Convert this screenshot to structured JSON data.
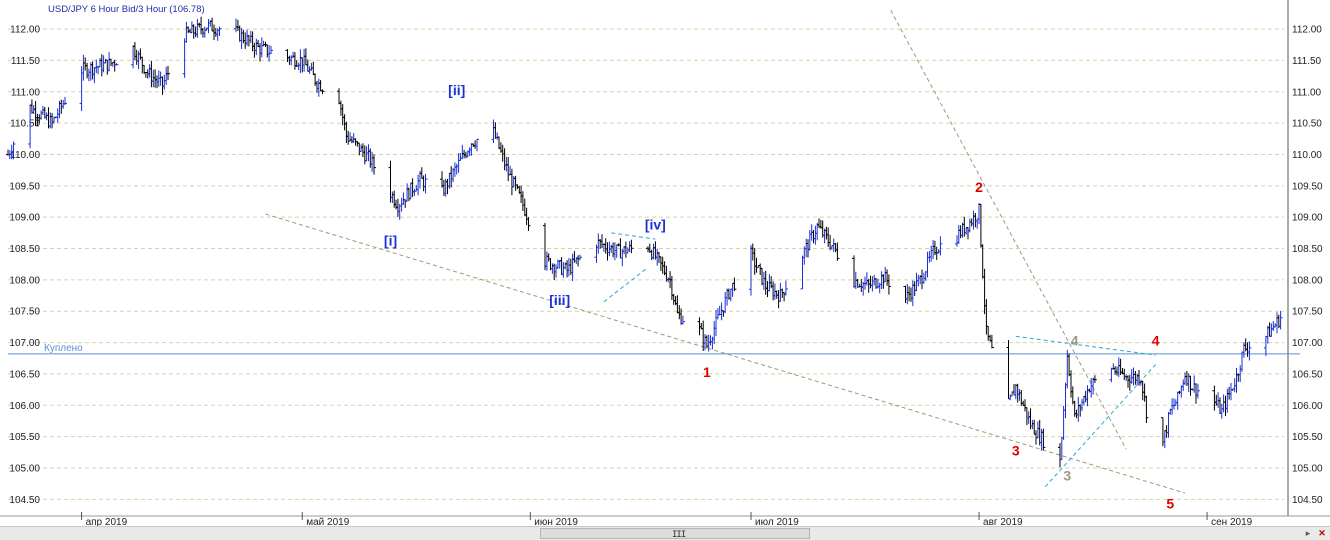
{
  "chart_data": {
    "type": "ohlc",
    "title": "USD/JPY 6 Hour Bid/3 Hour (106.78)",
    "instrument": "USD/JPY",
    "ylim": [
      104.25,
      112.4
    ],
    "y_ticks": [
      "112.00",
      "111.50",
      "111.00",
      "110.50",
      "110.00",
      "109.50",
      "109.00",
      "108.50",
      "108.00",
      "107.50",
      "107.00",
      "106.50",
      "106.00",
      "105.50",
      "105.00",
      "104.50"
    ],
    "x_ticks": [
      {
        "label": "апр 2019",
        "date": "2019-04-01"
      },
      {
        "label": "май 2019",
        "date": "2019-05-01"
      },
      {
        "label": "июн 2019",
        "date": "2019-06-01"
      },
      {
        "label": "июл 2019",
        "date": "2019-07-01"
      },
      {
        "label": "авг 2019",
        "date": "2019-08-01"
      },
      {
        "label": "сен 2019",
        "date": "2019-09-01"
      }
    ],
    "x_range": [
      "2019-03-22",
      "2019-09-12"
    ],
    "price_path": [
      [
        "2019-03-22",
        110.0
      ],
      [
        "2019-03-25",
        110.75
      ],
      [
        "2019-03-28",
        110.5
      ],
      [
        "2019-04-01",
        111.35
      ],
      [
        "2019-04-05",
        111.45
      ],
      [
        "2019-04-08",
        111.7
      ],
      [
        "2019-04-10",
        111.3
      ],
      [
        "2019-04-12",
        111.1
      ],
      [
        "2019-04-15",
        111.9
      ],
      [
        "2019-04-18",
        112.05
      ],
      [
        "2019-04-22",
        111.95
      ],
      [
        "2019-04-25",
        111.7
      ],
      [
        "2019-04-29",
        111.55
      ],
      [
        "2019-05-01",
        111.5
      ],
      [
        "2019-05-03",
        111.15
      ],
      [
        "2019-05-06",
        110.9
      ],
      [
        "2019-05-07",
        110.3
      ],
      [
        "2019-05-10",
        109.95
      ],
      [
        "2019-05-14",
        109.2
      ],
      [
        "2019-05-17",
        109.6
      ],
      [
        "2019-05-20",
        109.4
      ],
      [
        "2019-05-24",
        110.2
      ],
      [
        "2019-05-27",
        110.35
      ],
      [
        "2019-05-29",
        109.7
      ],
      [
        "2019-05-31",
        109.2
      ],
      [
        "2019-06-03",
        108.3
      ],
      [
        "2019-06-06",
        108.15
      ],
      [
        "2019-06-10",
        108.6
      ],
      [
        "2019-06-13",
        108.45
      ],
      [
        "2019-06-17",
        108.55
      ],
      [
        "2019-06-20",
        108.0
      ],
      [
        "2019-06-21",
        107.45
      ],
      [
        "2019-06-24",
        107.2
      ],
      [
        "2019-06-25",
        106.95
      ],
      [
        "2019-06-28",
        107.8
      ],
      [
        "2019-07-01",
        108.4
      ],
      [
        "2019-07-03",
        107.9
      ],
      [
        "2019-07-05",
        107.75
      ],
      [
        "2019-07-08",
        108.4
      ],
      [
        "2019-07-10",
        108.85
      ],
      [
        "2019-07-12",
        108.55
      ],
      [
        "2019-07-15",
        108.0
      ],
      [
        "2019-07-17",
        107.9
      ],
      [
        "2019-07-19",
        108.05
      ],
      [
        "2019-07-22",
        107.7
      ],
      [
        "2019-07-24",
        108.0
      ],
      [
        "2019-07-26",
        108.5
      ],
      [
        "2019-07-29",
        108.7
      ],
      [
        "2019-07-31",
        108.95
      ],
      [
        "2019-08-01",
        109.1
      ],
      [
        "2019-08-02",
        107.15
      ],
      [
        "2019-08-05",
        106.0
      ],
      [
        "2019-08-06",
        106.3
      ],
      [
        "2019-08-07",
        106.0
      ],
      [
        "2019-08-08",
        105.7
      ],
      [
        "2019-08-09",
        105.55
      ],
      [
        "2019-08-12",
        105.1
      ],
      [
        "2019-08-13",
        106.8
      ],
      [
        "2019-08-14",
        105.8
      ],
      [
        "2019-08-16",
        106.3
      ],
      [
        "2019-08-19",
        106.6
      ],
      [
        "2019-08-21",
        106.45
      ],
      [
        "2019-08-23",
        106.45
      ],
      [
        "2019-08-25",
        105.0
      ],
      [
        "2019-08-26",
        105.4
      ],
      [
        "2019-08-27",
        105.9
      ],
      [
        "2019-08-28",
        106.1
      ],
      [
        "2019-08-29",
        106.5
      ],
      [
        "2019-08-30",
        106.3
      ],
      [
        "2019-09-02",
        106.05
      ],
      [
        "2019-09-03",
        105.9
      ],
      [
        "2019-09-05",
        106.45
      ],
      [
        "2019-09-06",
        106.9
      ],
      [
        "2019-09-09",
        107.1
      ],
      [
        "2019-09-11",
        107.4
      ]
    ],
    "horizontal_lines": [
      {
        "label": "Куплено",
        "y": 106.82,
        "color": "#5a8fd6"
      }
    ],
    "wave_labels": [
      {
        "text": "[i]",
        "date": "2019-05-13",
        "price": 108.55,
        "color": "#1a2fd6"
      },
      {
        "text": "[ii]",
        "date": "2019-05-22",
        "price": 110.95,
        "color": "#1a2fd6"
      },
      {
        "text": "[iii]",
        "date": "2019-06-05",
        "price": 107.6,
        "color": "#1a2fd6"
      },
      {
        "text": "[iv]",
        "date": "2019-06-18",
        "price": 108.8,
        "color": "#1a2fd6"
      },
      {
        "text": "1",
        "date": "2019-06-25",
        "price": 106.45,
        "color": "#e00000"
      },
      {
        "text": "2",
        "date": "2019-08-01",
        "price": 109.4,
        "color": "#e00000"
      },
      {
        "text": "3",
        "date": "2019-08-06",
        "price": 105.2,
        "color": "#e00000"
      },
      {
        "text": "3",
        "date": "2019-08-13",
        "price": 104.8,
        "color": "#a09a80"
      },
      {
        "text": "4",
        "date": "2019-08-14",
        "price": 106.95,
        "color": "#a09a80"
      },
      {
        "text": "4",
        "date": "2019-08-25",
        "price": 106.95,
        "color": "#e00000"
      },
      {
        "text": "5",
        "date": "2019-08-27",
        "price": 104.35,
        "color": "#e00000"
      }
    ],
    "trendlines": [
      {
        "from": [
          "2019-04-26",
          109.05
        ],
        "to": [
          "2019-08-29",
          104.6
        ],
        "style": "dashed",
        "color": "#9c9684"
      },
      {
        "from": [
          "2019-07-20",
          112.3
        ],
        "to": [
          "2019-08-21",
          105.3
        ],
        "style": "dashed",
        "color": "#9c9684"
      },
      {
        "from": [
          "2019-06-12",
          108.75
        ],
        "to": [
          "2019-06-18",
          108.65
        ],
        "style": "dashed",
        "color": "#2aa8d8"
      },
      {
        "from": [
          "2019-06-11",
          107.65
        ],
        "to": [
          "2019-06-17",
          108.2
        ],
        "style": "dashed",
        "color": "#2aa8d8"
      },
      {
        "from": [
          "2019-08-06",
          107.1
        ],
        "to": [
          "2019-08-25",
          106.8
        ],
        "style": "dashed",
        "color": "#2aa8d8"
      },
      {
        "from": [
          "2019-08-10",
          104.7
        ],
        "to": [
          "2019-08-25",
          106.65
        ],
        "style": "dashed",
        "color": "#2aa8d8"
      }
    ],
    "colors": {
      "bar_up": "#1a2fd6",
      "bar_down": "#000000",
      "grid": "#d8d2a8",
      "axis_text": "#222222",
      "title_text": "#1a2fa8"
    },
    "grid": true
  },
  "scrollbar": {
    "grip": "III",
    "left_arrow": "◂",
    "right_arrow": "▸",
    "close_glyph": "✕"
  }
}
